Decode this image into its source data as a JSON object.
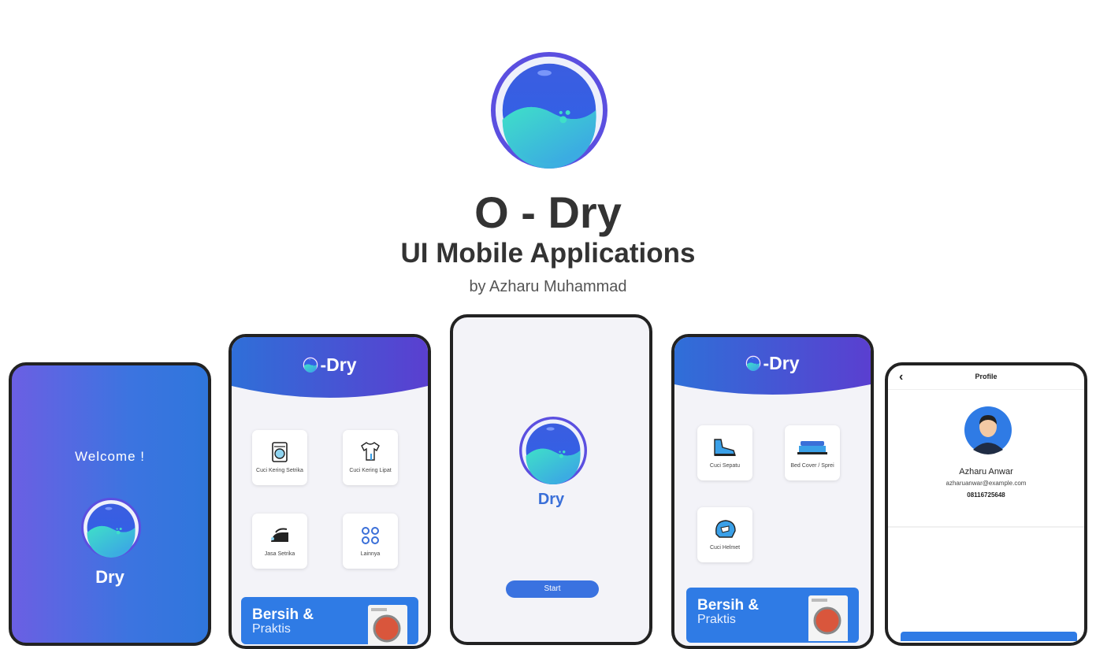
{
  "hero": {
    "title": "O - Dry",
    "subtitle": "UI Mobile Applications",
    "author": "by Azharu Muhammad"
  },
  "welcome_screen": {
    "greeting": "Welcome !",
    "brand": "Dry"
  },
  "home_screen": {
    "brand": "-Dry",
    "tiles": [
      {
        "label": "Cuci Kering Setrika",
        "icon": "washing-machine-icon"
      },
      {
        "label": "Cuci Kering Lipat",
        "icon": "shirt-icon"
      },
      {
        "label": "Jasa Setrika",
        "icon": "iron-icon"
      },
      {
        "label": "Lainnya",
        "icon": "more-grid-icon"
      }
    ],
    "promo": {
      "line1": "Bersih &",
      "line2": "Praktis"
    }
  },
  "start_screen": {
    "brand": "Dry",
    "start_label": "Start"
  },
  "services_screen": {
    "brand": "-Dry",
    "tiles": [
      {
        "label": "Cuci Sepatu",
        "icon": "shoe-icon"
      },
      {
        "label": "Bed Cover / Sprei",
        "icon": "bed-icon"
      },
      {
        "label": "Cuci Helmet",
        "icon": "helmet-icon"
      }
    ],
    "promo": {
      "line1": "Bersih &",
      "line2": "Praktis"
    }
  },
  "profile_screen": {
    "title": "Profile",
    "name": "Azharu Anwar",
    "email": "azharuanwar@example.com",
    "phone": "08116725648"
  },
  "colors": {
    "brand_blue": "#3a6fd8",
    "gradient_purple": "#6b5fe3",
    "promo_blue": "#2f7be5"
  }
}
